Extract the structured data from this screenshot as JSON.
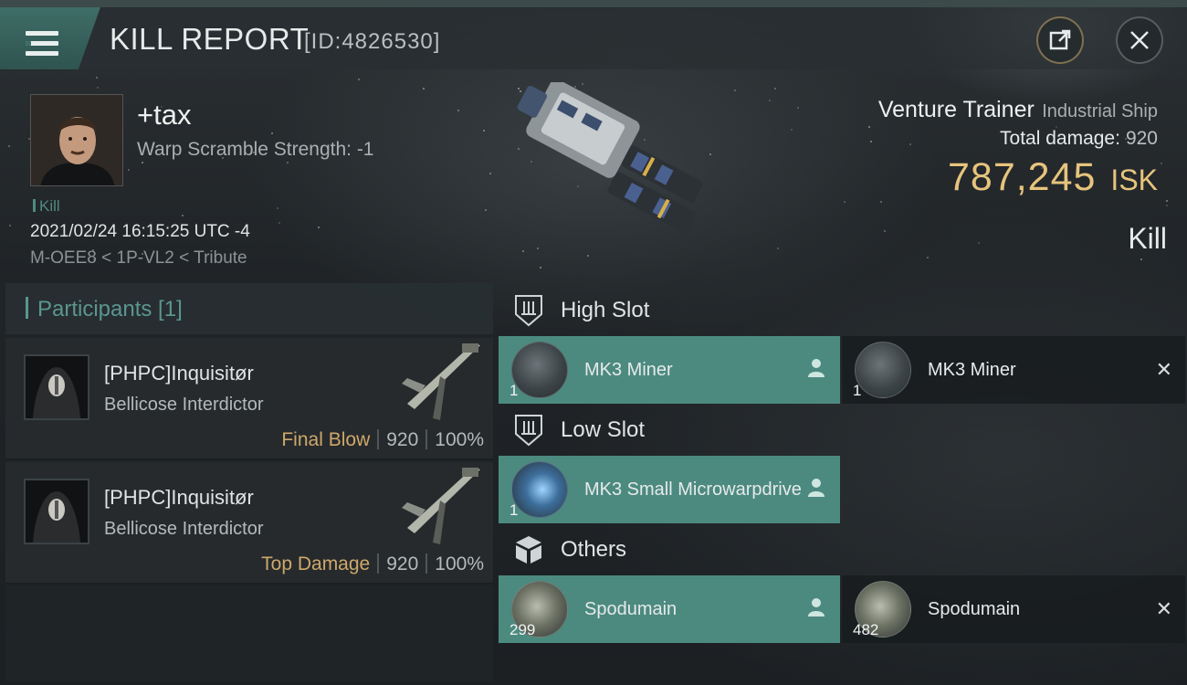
{
  "header": {
    "title": "KILL REPORT",
    "id_label": "[ID:4826530]"
  },
  "victim": {
    "name": "+tax",
    "warp_scramble": "Warp Scramble Strength: -1",
    "kill_tag": "Kill",
    "datetime": "2021/02/24 16:15:25 UTC -4",
    "location": "M-OEE8 < 1P-VL2 < Tribute"
  },
  "ship": {
    "name": "Venture Trainer",
    "class": "Industrial Ship",
    "total_damage_label": "Total damage:",
    "total_damage_value": "920",
    "isk_value": "787,245",
    "isk_unit": "ISK",
    "kill_type": "Kill"
  },
  "participants": {
    "title": "Participants [1]",
    "rows": [
      {
        "name": "[PHPC]Inquisitør",
        "ship": "Bellicose Interdictor",
        "role": "Final Blow",
        "damage": "920",
        "percent": "100%"
      },
      {
        "name": "[PHPC]Inquisitør",
        "ship": "Bellicose Interdictor",
        "role": "Top Damage",
        "damage": "920",
        "percent": "100%"
      }
    ]
  },
  "slots": {
    "high": {
      "label": "High Slot",
      "items": [
        {
          "name": "MK3 Miner",
          "qty": "1",
          "state": "dropped"
        },
        {
          "name": "MK3 Miner",
          "qty": "1",
          "state": "destroyed"
        }
      ]
    },
    "low": {
      "label": "Low Slot",
      "items": [
        {
          "name": "MK3 Small Microwarpdrive",
          "qty": "1",
          "state": "dropped"
        }
      ]
    },
    "others": {
      "label": "Others",
      "items": [
        {
          "name": "Spodumain",
          "qty": "299",
          "state": "dropped"
        },
        {
          "name": "Spodumain",
          "qty": "482",
          "state": "destroyed"
        }
      ]
    }
  },
  "colors": {
    "accent_teal": "#4c8a80",
    "isk_gold": "#e6c47d",
    "role_gold": "#cfa86a"
  },
  "icons": {
    "menu": "hamburger-icon",
    "share": "share-icon",
    "close": "close-icon",
    "dropped": "person-icon",
    "destroyed": "x-icon"
  }
}
